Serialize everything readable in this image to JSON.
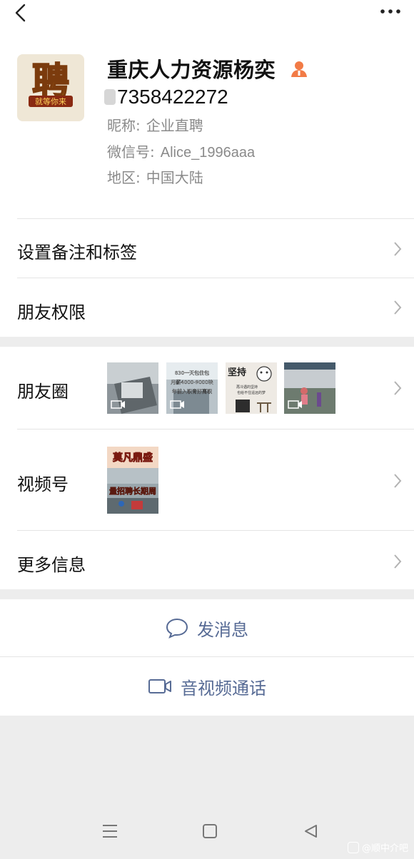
{
  "profile": {
    "name": "重庆人力资源杨奕",
    "phone": "7358422272",
    "nickname_label": "昵称:",
    "nickname": "企业直聘",
    "wechat_id_label": "微信号:",
    "wechat_id": "Alice_1996aaa",
    "region_label": "地区:",
    "region": "中国大陆",
    "avatar_char": "聘",
    "avatar_caption": "就等你来"
  },
  "menu": {
    "remark_tags": "设置备注和标签",
    "friend_permissions": "朋友权限",
    "moments": "朋友圈",
    "channels": "视频号",
    "more_info": "更多信息"
  },
  "moments_thumbs": [
    {
      "kind": "video",
      "overlay": ""
    },
    {
      "kind": "video",
      "overlay_line1": "830一天包住包",
      "overlay_line2": "月薪4000-9000块",
      "overlay_line3": "年前入职青好离职"
    },
    {
      "kind": "image",
      "overlay_title": "坚持",
      "overlay_line1": "再冷遇的坚持",
      "overlay_line2": "也给不住遥远的梦"
    },
    {
      "kind": "video",
      "overlay": ""
    }
  ],
  "channels_thumb": {
    "line1": "莫凡鼎盛",
    "line2": "量招聘长期周"
  },
  "actions": {
    "send_message": "发消息",
    "video_call": "音视频通话"
  },
  "watermark": "@顺中介吧",
  "colors": {
    "link_blue": "#576b95",
    "separator_gray": "#ededed",
    "badge_orange": "#f27b46"
  }
}
